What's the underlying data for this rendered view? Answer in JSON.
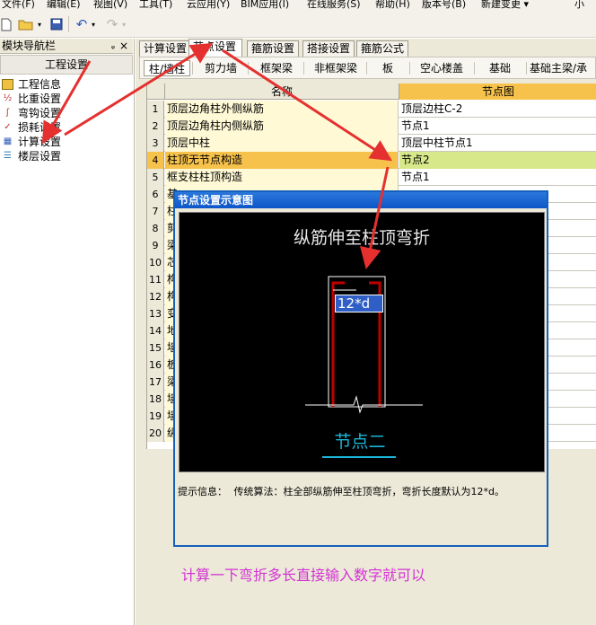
{
  "menubar": {
    "items": [
      "文件(F)",
      "编辑(E)",
      "视图(V)",
      "工具(T)",
      "云应用(Y)",
      "BIM应用(I)",
      "在线服务(S)",
      "帮助(H)",
      "版本号(B)",
      "新建变更 ▾",
      "小"
    ]
  },
  "toolbar": {
    "icons": [
      "new-file-icon",
      "open-folder-icon",
      "save-icon",
      "undo-icon",
      "redo-icon"
    ]
  },
  "nav": {
    "title": "模块导航栏",
    "pin": "ᵩ",
    "close": "×",
    "section": "工程设置",
    "items": [
      {
        "label": "工程信息",
        "icon": "info-icon"
      },
      {
        "label": "比重设置",
        "icon": "ratio-icon"
      },
      {
        "label": "弯钩设置",
        "icon": "hook-icon"
      },
      {
        "label": "损耗设置",
        "icon": "loss-icon"
      },
      {
        "label": "计算设置",
        "icon": "calc-icon"
      },
      {
        "label": "楼层设置",
        "icon": "floor-icon"
      }
    ]
  },
  "tabs": {
    "top": [
      "计算设置",
      "节点设置",
      "箍筋设置",
      "搭接设置",
      "箍筋公式"
    ],
    "active_top": 1,
    "sub": [
      "柱/墙柱",
      "剪力墙",
      "框架梁",
      "非框架梁",
      "板",
      "空心楼盖",
      "基础",
      "基础主梁/承"
    ],
    "active_sub": 0
  },
  "grid": {
    "headers": [
      "名称",
      "节点图"
    ],
    "rows": [
      {
        "n": "1",
        "name": "顶层边角柱外侧纵筋",
        "value": "顶层边柱C-2"
      },
      {
        "n": "2",
        "name": "顶层边角柱内侧纵筋",
        "value": "节点1"
      },
      {
        "n": "3",
        "name": "顶层中柱",
        "value": "顶层中柱节点1"
      },
      {
        "n": "4",
        "name": "柱顶无节点构造",
        "value": "节点2"
      },
      {
        "n": "5",
        "name": "框支柱柱顶构造",
        "value": "节点1"
      },
      {
        "n": "6",
        "name": "基",
        "value": ""
      },
      {
        "n": "7",
        "name": "柱",
        "value": ""
      },
      {
        "n": "8",
        "name": "剪",
        "value": ""
      },
      {
        "n": "9",
        "name": "梁",
        "value": ""
      },
      {
        "n": "10",
        "name": "芯",
        "value": ""
      },
      {
        "n": "11",
        "name": "构",
        "value": ""
      },
      {
        "n": "12",
        "name": "构",
        "value": ""
      },
      {
        "n": "13",
        "name": "变",
        "value": ""
      },
      {
        "n": "14",
        "name": "地",
        "value": ""
      },
      {
        "n": "15",
        "name": "墙",
        "value": ""
      },
      {
        "n": "16",
        "name": "板",
        "value": ""
      },
      {
        "n": "17",
        "name": "梁",
        "value": ""
      },
      {
        "n": "18",
        "name": "墙",
        "value": ""
      },
      {
        "n": "19",
        "name": "墙",
        "value": ""
      },
      {
        "n": "20",
        "name": "纵",
        "value": ""
      }
    ],
    "highlight_row": 3
  },
  "dialog": {
    "title": "节点设置示意图",
    "heading": "纵筋伸至柱顶弯折",
    "input_value": "12*d",
    "node_label": "节点二",
    "hint_label": "提示信息：",
    "hint_text": "传统算法：柱全部纵筋伸至柱顶弯折，弯折长度默认为12*d。"
  },
  "annotation": "计算一下弯折多长直接输入数字就可以",
  "colors": {
    "arrow": "#e4312f",
    "annotation": "#d433d4",
    "header_selected": "#f6c24c",
    "row_value_selected": "#d7e88a",
    "dialog_title": "#0d55c8",
    "rebar": "#c00000",
    "node_label": "#19b6d8"
  }
}
